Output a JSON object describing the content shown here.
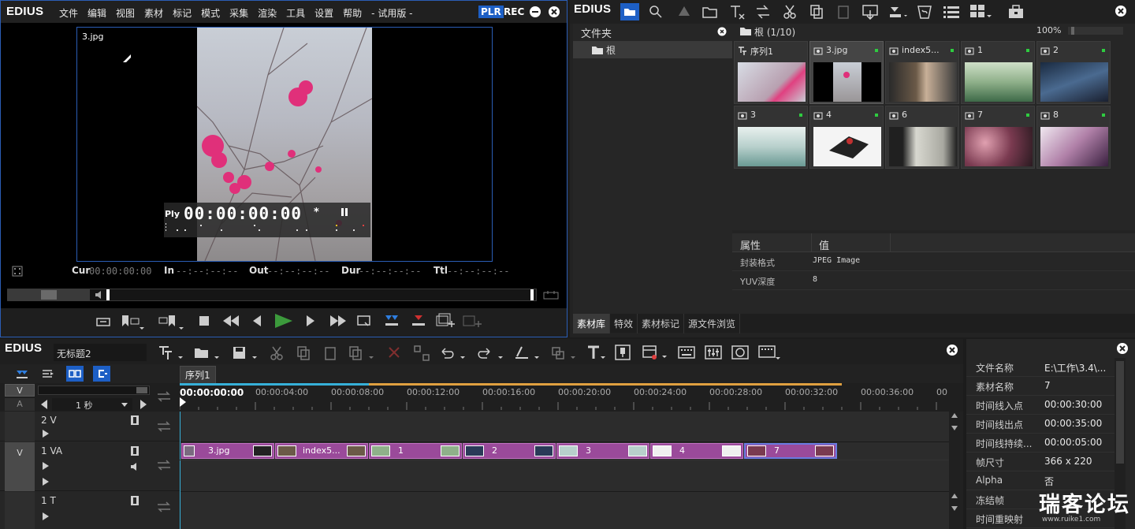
{
  "player": {
    "brand": "EDIUS",
    "menu": [
      "文件",
      "编辑",
      "视图",
      "素材",
      "标记",
      "模式",
      "采集",
      "渲染",
      "工具",
      "设置",
      "帮助"
    ],
    "edition": "- 试用版 -",
    "plr": "PLR",
    "rec": "REC",
    "clip_name": "3.jpg",
    "ply_label": "Ply",
    "timecode": "00:00:00:00",
    "tc_star": "*",
    "cur_label": "Cur",
    "cur_value": "00:00:00:00",
    "in_label": "In",
    "in_value": "--:--:--:--",
    "out_label": "Out",
    "out_value": "--:--:--:--",
    "dur_label": "Dur",
    "dur_value": "--:--:--:--",
    "ttl_label": "Ttl",
    "ttl_value": "--:--:--:--"
  },
  "bin": {
    "brand": "EDIUS",
    "folder_header": "文件夹",
    "root_folder": "根",
    "path": "根 (1/10)",
    "zoom": "100%",
    "tiles": [
      {
        "label": "序列1",
        "dot": false,
        "selected": false
      },
      {
        "label": "3.jpg",
        "dot": true,
        "selected": true
      },
      {
        "label": "index5...",
        "dot": true,
        "selected": false
      },
      {
        "label": "1",
        "dot": true,
        "selected": false
      },
      {
        "label": "2",
        "dot": true,
        "selected": false
      },
      {
        "label": "3",
        "dot": true,
        "selected": false
      },
      {
        "label": "4",
        "dot": true,
        "selected": false
      },
      {
        "label": "6",
        "dot": true,
        "selected": false
      },
      {
        "label": "7",
        "dot": true,
        "selected": false
      },
      {
        "label": "8",
        "dot": true,
        "selected": false
      }
    ],
    "props_header_name": "属性",
    "props_header_value": "值",
    "props": [
      {
        "name": "封装格式",
        "value": "JPEG Image"
      },
      {
        "name": "YUV深度",
        "value": "8"
      }
    ],
    "tabs": [
      "素材库",
      "特效",
      "素材标记",
      "源文件浏览"
    ]
  },
  "timeline": {
    "brand": "EDIUS",
    "project_name": "无标题2",
    "sequence_tab": "序列1",
    "scale": "1 秒",
    "ruler": [
      "00:00:00:00",
      "00:00:04:00",
      "00:00:08:00",
      "00:00:12:00",
      "00:00:16:00",
      "00:00:20:00",
      "00:00:24:00",
      "00:00:28:00",
      "00:00:32:00",
      "00:00:36:00",
      "00"
    ],
    "patch_v": "V",
    "patch_a": "A",
    "tracks": [
      {
        "name": "2 V",
        "patch": ""
      },
      {
        "name": "1 VA",
        "patch": "V"
      },
      {
        "name": "1 T",
        "patch": ""
      }
    ],
    "clips": [
      "3.jpg",
      "index5...",
      "1",
      "2",
      "3",
      "4",
      "7"
    ]
  },
  "info": {
    "rows": [
      {
        "key": "文件名称",
        "value": "E:\\工作\\3.4\\..."
      },
      {
        "key": "素材名称",
        "value": "7"
      },
      {
        "key": "时间线入点",
        "value": "00:00:30:00"
      },
      {
        "key": "时间线出点",
        "value": "00:00:35:00"
      },
      {
        "key": "时间线持续...",
        "value": "00:00:05:00"
      },
      {
        "key": "帧尺寸",
        "value": "366 x 220"
      },
      {
        "key": "Alpha",
        "value": "否"
      },
      {
        "key": "冻结帧",
        "value": ""
      },
      {
        "key": "时间重映射",
        "value": ""
      }
    ],
    "watermark": "瑞客论坛",
    "watermark_url": "www.ruike1.com"
  },
  "colors": {
    "accent": "#2b5db5",
    "clip": "#a04da0",
    "play_green": "#3c9a3c",
    "status_dot": "#2ecc40"
  }
}
